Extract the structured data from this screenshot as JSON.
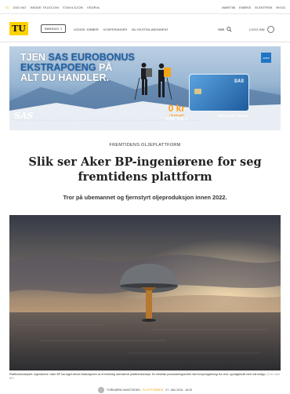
{
  "topbar": {
    "links": [
      "TU",
      "DIGI.NO",
      "INSIDE TELECOM",
      "STAVILSJON",
      "VEDRIA"
    ],
    "right_links": [
      "MARITIM",
      "ENERGI",
      "ELEKTRISK",
      "BYGG"
    ]
  },
  "header": {
    "logo": "TU",
    "menu_label": "INNHOLD",
    "nav": [
      "LEDIGE JOBBER",
      "KONFERANSER",
      "BLI EKSTRA-ABONNENT"
    ],
    "search_label": "SØK",
    "login_label": "LOGG INN"
  },
  "ad": {
    "headline_line1_white": "TJEN ",
    "headline_line1_blue": "SAS EUROBONUS",
    "headline_line2_blue": "EKSTRAPOENG",
    "headline_line2_white": " PÅ",
    "headline_line3": "ALT DU HANDLER.",
    "brand": "SAS",
    "offer_amount": "0 kr",
    "offer_sub": "i årsavgift",
    "cta": "SØK HÅ >",
    "card_name": "SAS",
    "card_label": "SAS Amex Classic",
    "fine_print": "TOLKER: SAS Amex Classic-kunder tjener poeng på nye kjøp til 31.mars. Se betingelser og vilkår på sasamex.no. Ekstrapoeng gjelder for nye kunder og tas. Eventuelt andre vilkår gjelder. For TA Bidrag: ingen annonsert sas4a"
  },
  "article": {
    "kicker": "FREMTIDENS OLJEPLATTFORM",
    "title": "Slik ser Aker BP-ingeniørene for seg fremtidens plattform",
    "lead": "Tror på ubemannet og fjernstyrt oljeproduksjon innen 2022.",
    "caption": "Plattformkonseptet: Ingeniørene i Aker BP har laget denne illustrasjonen av et fremtidig ubemannet plattformkonsept. En elektrisk prosesseringsenhet med forsyningsenergi fra vind- og bølgekraft med null utslipp.",
    "caption_credit": "(Foto: Aker BP)",
    "author": "TORBJØRN HANSTEDEN",
    "author_extra": "PLATTFORMER",
    "date": "27. JAN 2018 - 18:29"
  }
}
